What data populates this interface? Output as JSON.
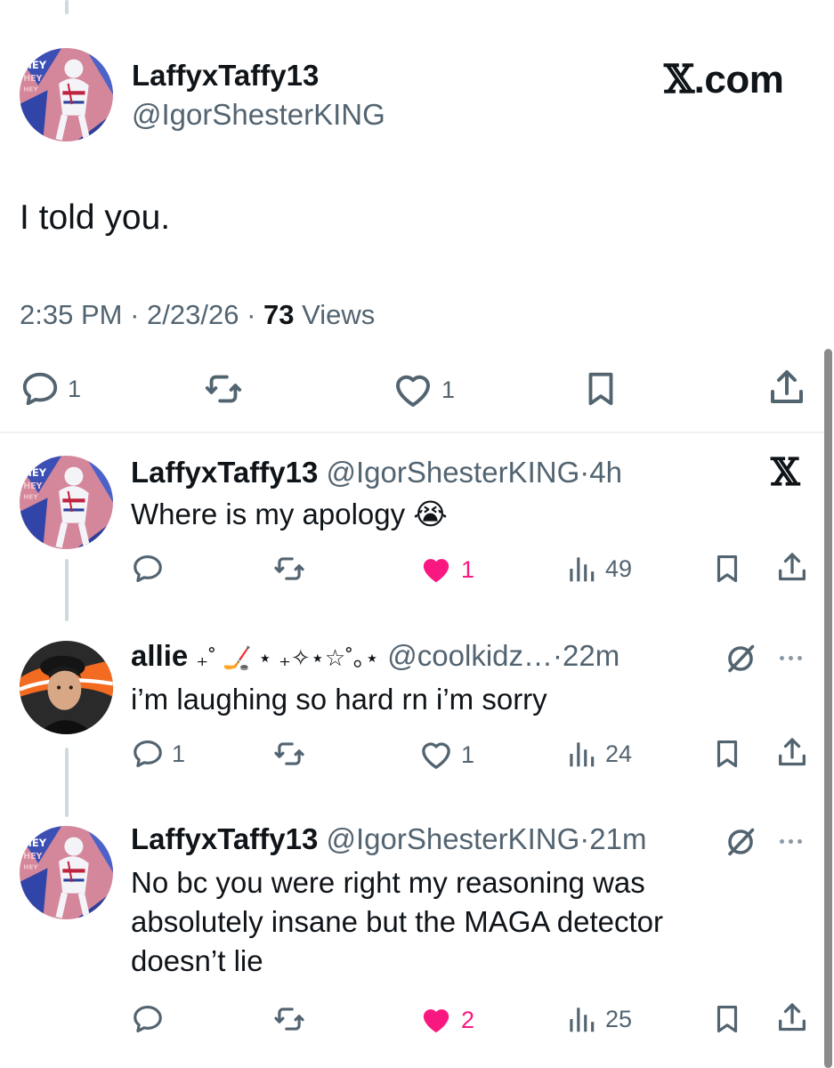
{
  "brand": {
    "site": ".com",
    "x_glyph": "𝕏"
  },
  "main_tweet": {
    "name": "LaffyxTaffy13",
    "handle": "@IgorShesterKING",
    "text": "I told you.",
    "time": "2:35 PM",
    "date": "2/23/26",
    "views_count": "73",
    "views_label": "Views",
    "separator": "·",
    "replies": "1",
    "likes": "1"
  },
  "replies": [
    {
      "name": "LaffyxTaffy13",
      "handle": "@IgorShesterKING",
      "time": "4h",
      "text": "Where is my apology 😭",
      "badge_icon": "x-logo-icon",
      "replies": "",
      "likes": "1",
      "liked": true,
      "views": "49"
    },
    {
      "name": "allie",
      "name_decor": "₊˚ 🏒 ⋆ ₊✧⋆☆˚｡⋆",
      "handle": "@coolkidz…",
      "time": "22m",
      "text": "i’m laughing so hard rn i’m sorry",
      "badge_icon": "grok-icon",
      "replies": "1",
      "likes": "1",
      "liked": false,
      "views": "24"
    },
    {
      "name": "LaffyxTaffy13",
      "handle": "@IgorShesterKING",
      "time": "21m",
      "text": "No bc you were right my reasoning was absolutely insane but the MAGA detector doesn’t lie",
      "badge_icon": "grok-icon",
      "replies": "",
      "likes": "2",
      "liked": true,
      "views": "25"
    }
  ],
  "colors": {
    "accent_like": "#f91880",
    "muted": "#536471",
    "text": "#0f1419",
    "thread_line": "#cfd9de"
  }
}
